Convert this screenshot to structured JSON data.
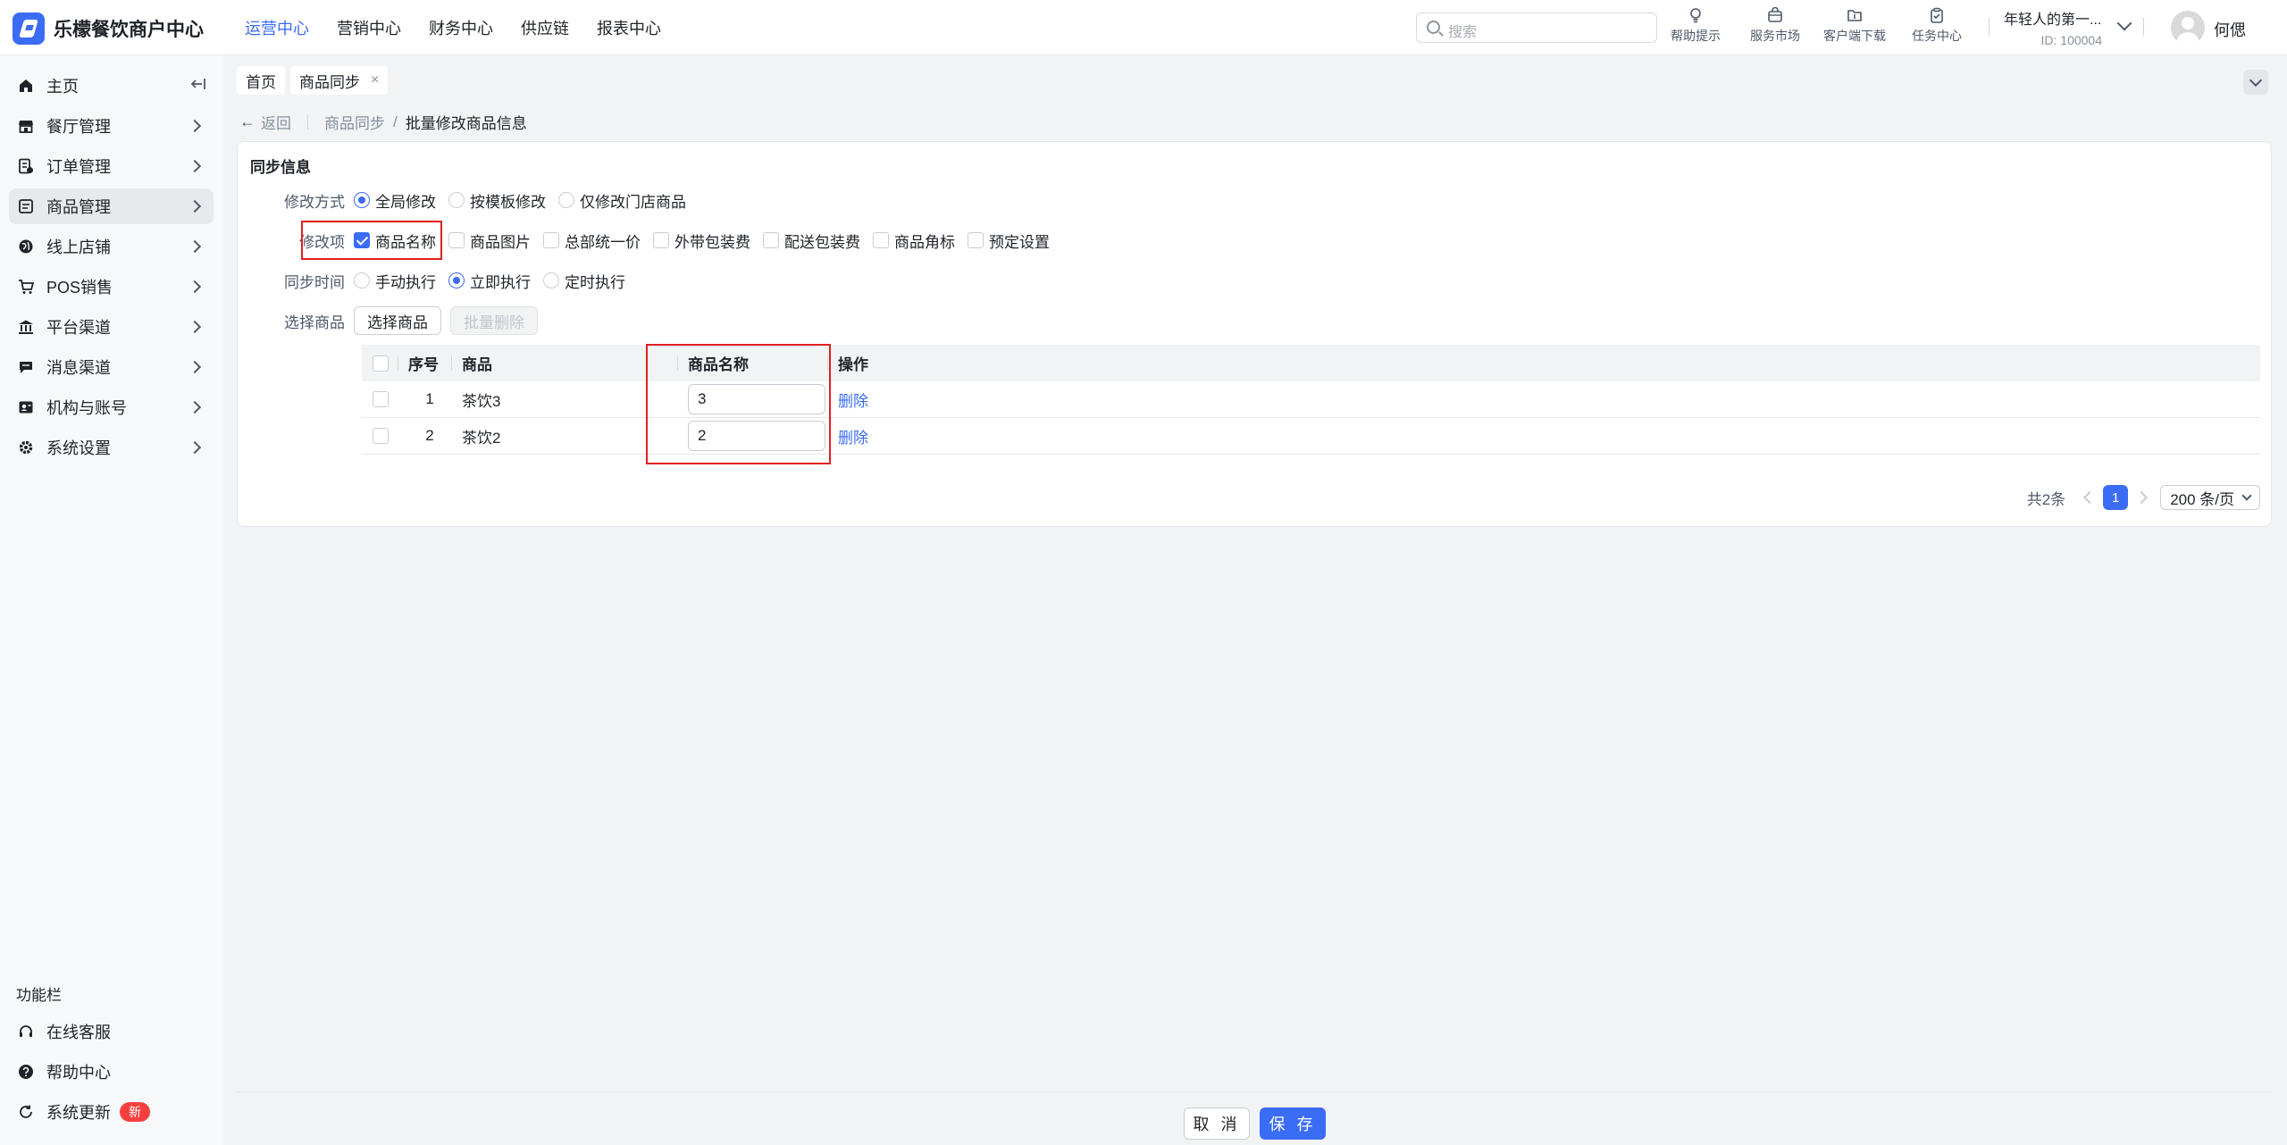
{
  "app": {
    "title": "乐檬餐饮商户中心"
  },
  "topnav": [
    "运营中心",
    "营销中心",
    "财务中心",
    "供应链",
    "报表中心"
  ],
  "search": {
    "placeholder": "搜索"
  },
  "tools": [
    "帮助提示",
    "服务市场",
    "客户端下载",
    "任务中心"
  ],
  "tenant": {
    "name": "年轻人的第一...",
    "id": "ID: 100004"
  },
  "user": {
    "name": "何偲"
  },
  "sidebar": {
    "items": [
      {
        "label": "主页",
        "icon": "home-icon"
      },
      {
        "label": "餐厅管理",
        "icon": "store-icon"
      },
      {
        "label": "订单管理",
        "icon": "order-icon"
      },
      {
        "label": "商品管理",
        "icon": "goods-icon"
      },
      {
        "label": "线上店铺",
        "icon": "globe-icon"
      },
      {
        "label": "POS销售",
        "icon": "cart-icon"
      },
      {
        "label": "平台渠道",
        "icon": "bank-icon"
      },
      {
        "label": "消息渠道",
        "icon": "message-icon"
      },
      {
        "label": "机构与账号",
        "icon": "account-icon"
      },
      {
        "label": "系统设置",
        "icon": "gear-icon"
      }
    ],
    "section_title": "功能栏",
    "func_items": [
      {
        "label": "在线客服",
        "icon": "headset-icon"
      },
      {
        "label": "帮助中心",
        "icon": "help-icon"
      },
      {
        "label": "系统更新",
        "icon": "refresh-icon",
        "badge": "新"
      }
    ]
  },
  "tabs": [
    {
      "label": "首页"
    },
    {
      "label": "商品同步",
      "close": "×"
    }
  ],
  "breadcrumb": {
    "back": "返回",
    "parent": "商品同步",
    "sep": "/",
    "current": "批量修改商品信息"
  },
  "card": {
    "title": "同步信息",
    "mode": {
      "label": "修改方式",
      "options": [
        "全局修改",
        "按模板修改",
        "仅修改门店商品"
      ],
      "selected": 0
    },
    "items": {
      "label": "修改项",
      "options": [
        "商品名称",
        "商品图片",
        "总部统一价",
        "外带包装费",
        "配送包装费",
        "商品角标",
        "预定设置"
      ],
      "checked": [
        true,
        false,
        false,
        false,
        false,
        false,
        false
      ]
    },
    "sync_time": {
      "label": "同步时间",
      "options": [
        "手动执行",
        "立即执行",
        "定时执行"
      ],
      "selected": 1
    },
    "select_goods": {
      "label": "选择商品",
      "choose_btn": "选择商品",
      "batch_delete_btn": "批量删除"
    }
  },
  "table": {
    "headers": {
      "index": "序号",
      "goods": "商品",
      "name": "商品名称",
      "action": "操作"
    },
    "rows": [
      {
        "index": "1",
        "goods": "茶饮3",
        "name": "3",
        "action": "删除"
      },
      {
        "index": "2",
        "goods": "茶饮2",
        "name": "2",
        "action": "删除"
      }
    ]
  },
  "pager": {
    "total": "共2条",
    "page": "1",
    "page_size": "200 条/页"
  },
  "footer": {
    "cancel": "取 消",
    "save": "保 存"
  },
  "colors": {
    "accent": "#3b6cf5",
    "highlight": "#e02020",
    "badge": "#f53f3f"
  }
}
